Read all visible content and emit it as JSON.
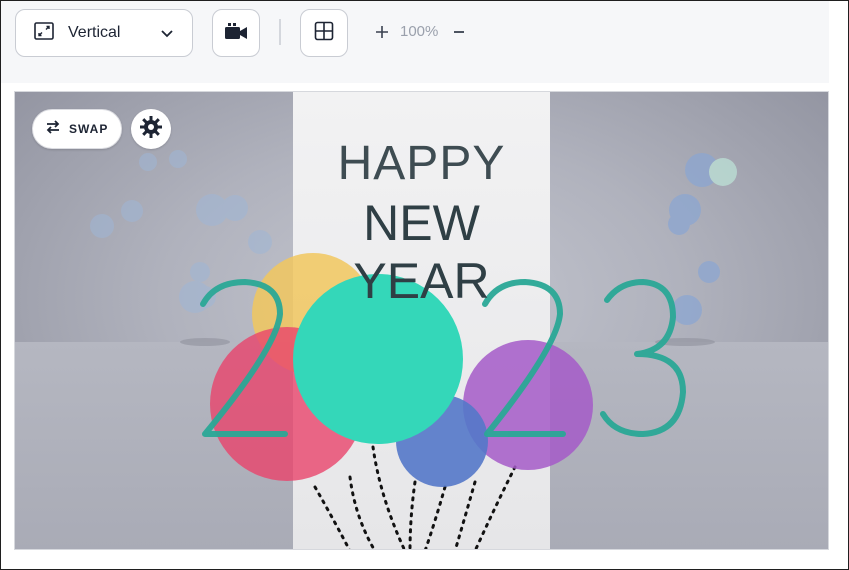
{
  "toolbar": {
    "orientation_label": "Vertical",
    "zoom_value": "100%"
  },
  "canvas": {
    "swap_label": "SWAP",
    "card": {
      "line1": "HAPPY",
      "line2": "NEW YEAR",
      "year": "2023"
    }
  },
  "colors": {
    "accent_teal": "#34d7b9",
    "balloon_yellow": "#f1c75e",
    "balloon_red": "#e8436b",
    "balloon_blue": "#5478c9",
    "balloon_purple": "#a45bc8",
    "text_dark": "#2f3f45"
  },
  "icons": [
    "resize-icon",
    "chevron-down-icon",
    "video-camera-icon",
    "grid-layout-icon",
    "zoom-in-icon",
    "zoom-out-icon",
    "swap-icon",
    "gear-icon"
  ]
}
